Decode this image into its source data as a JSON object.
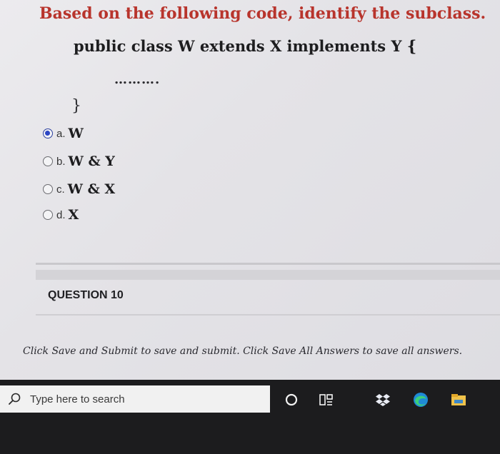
{
  "question": {
    "prompt": "Based on the following code, identify the subclass.",
    "code_line": "public class W extends X implements Y {",
    "code_ellipsis": "……….",
    "code_close": "}"
  },
  "options": [
    {
      "letter": "a.",
      "text": "W",
      "selected": true
    },
    {
      "letter": "b.",
      "text": "W & Y",
      "selected": false
    },
    {
      "letter": "c.",
      "text": "W & X",
      "selected": false
    },
    {
      "letter": "d.",
      "text": "X",
      "selected": false
    }
  ],
  "next_question": {
    "label": "QUESTION 10"
  },
  "footer": {
    "instructions": "Click Save and Submit to save and submit. Click Save All Answers to save all answers."
  },
  "taskbar": {
    "search_placeholder": "Type here to search",
    "icons": [
      "cortana-icon",
      "task-view-icon",
      "dropbox-icon",
      "edge-icon",
      "file-explorer-icon"
    ]
  },
  "colors": {
    "title": "#b8342c",
    "radio_selected": "#2c46c4",
    "taskbar": "#1c1c1e"
  }
}
